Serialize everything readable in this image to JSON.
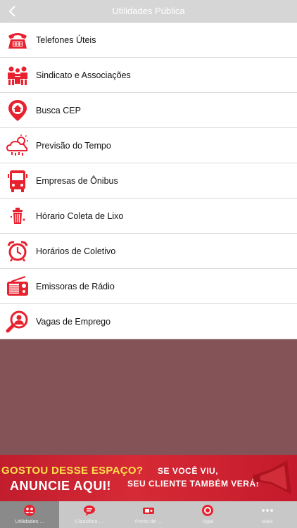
{
  "header": {
    "title": "Utilidades Pública",
    "back_icon": "chevron-left-icon"
  },
  "items": [
    {
      "label": "Telefones Úteis",
      "icon": "telephone-icon"
    },
    {
      "label": "Sindicato e Associações",
      "icon": "meeting-people-icon"
    },
    {
      "label": "Busca CEP",
      "icon": "location-pin-home-icon"
    },
    {
      "label": "Previsão do Tempo",
      "icon": "weather-cloud-icon"
    },
    {
      "label": "Empresas de Ônibus",
      "icon": "bus-icon"
    },
    {
      "label": "Hórario Coleta de Lixo",
      "icon": "trash-bin-icon"
    },
    {
      "label": "Horários de Coletivo",
      "icon": "alarm-clock-icon"
    },
    {
      "label": "Emissoras de Rádio",
      "icon": "radio-icon"
    },
    {
      "label": "Vagas de Emprego",
      "icon": "job-search-icon"
    }
  ],
  "banner": {
    "line1": "GOSTOU DESSE ESPAÇO?",
    "line2": "ANUNCIE AQUI!",
    "line3": "SE VOCÊ VIU,",
    "line4": "SEU CLIENTE TAMBÉM VERÁ!",
    "icon": "megaphone-icon"
  },
  "tabs": [
    {
      "label": "Utilidades ...",
      "icon": "people-icon",
      "active": true
    },
    {
      "label": "Classifica ...",
      "icon": "speech-bubble-icon",
      "active": false
    },
    {
      "label": "Ponto de ...",
      "icon": "ticket-icon",
      "active": false
    },
    {
      "label": "Agal",
      "icon": "badge-icon",
      "active": false
    },
    {
      "label": "Mais",
      "icon": "more-dots-icon",
      "active": false
    }
  ],
  "colors": {
    "accent": "#e8212f",
    "list_bg": "#ffffff",
    "empty_area": "#835358",
    "navbar": "#d6d6d6",
    "tabbar": "#c8c8c8"
  }
}
